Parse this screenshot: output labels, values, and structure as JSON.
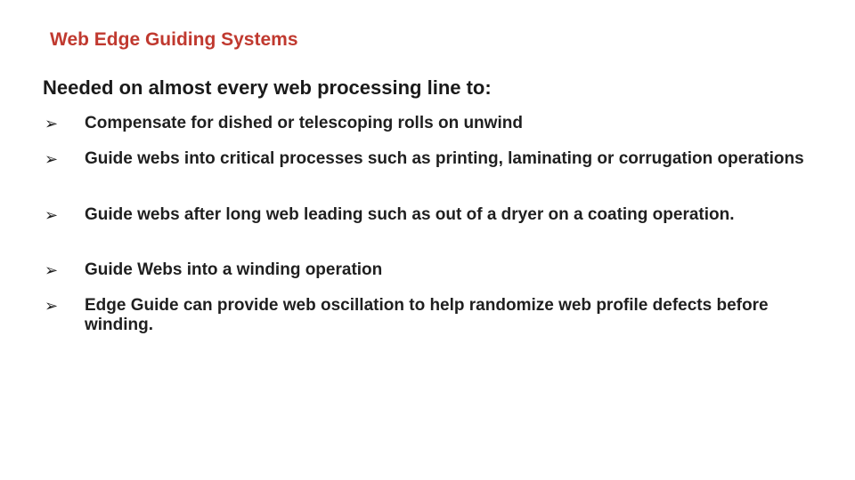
{
  "slide": {
    "title": "Web Edge Guiding Systems",
    "subtitle": "Needed on almost every web processing line to:",
    "bullet_icon": "arrow-bullet-icon",
    "bullet_glyph": "➢",
    "bullets": [
      {
        "text": "Compensate for dished or telescoping rolls on unwind"
      },
      {
        "text": "Guide webs into critical processes such as printing, laminating or corrugation operations"
      },
      {
        "text": "Guide webs after long web leading such as out of a dryer on a coating operation."
      },
      {
        "text": "Guide Webs into a winding operation"
      },
      {
        "text": "Edge Guide can provide web oscillation to help randomize web profile defects before winding."
      }
    ],
    "colors": {
      "title": "#c0392f",
      "body_text": "#1f1f1f",
      "background": "#ffffff"
    }
  }
}
